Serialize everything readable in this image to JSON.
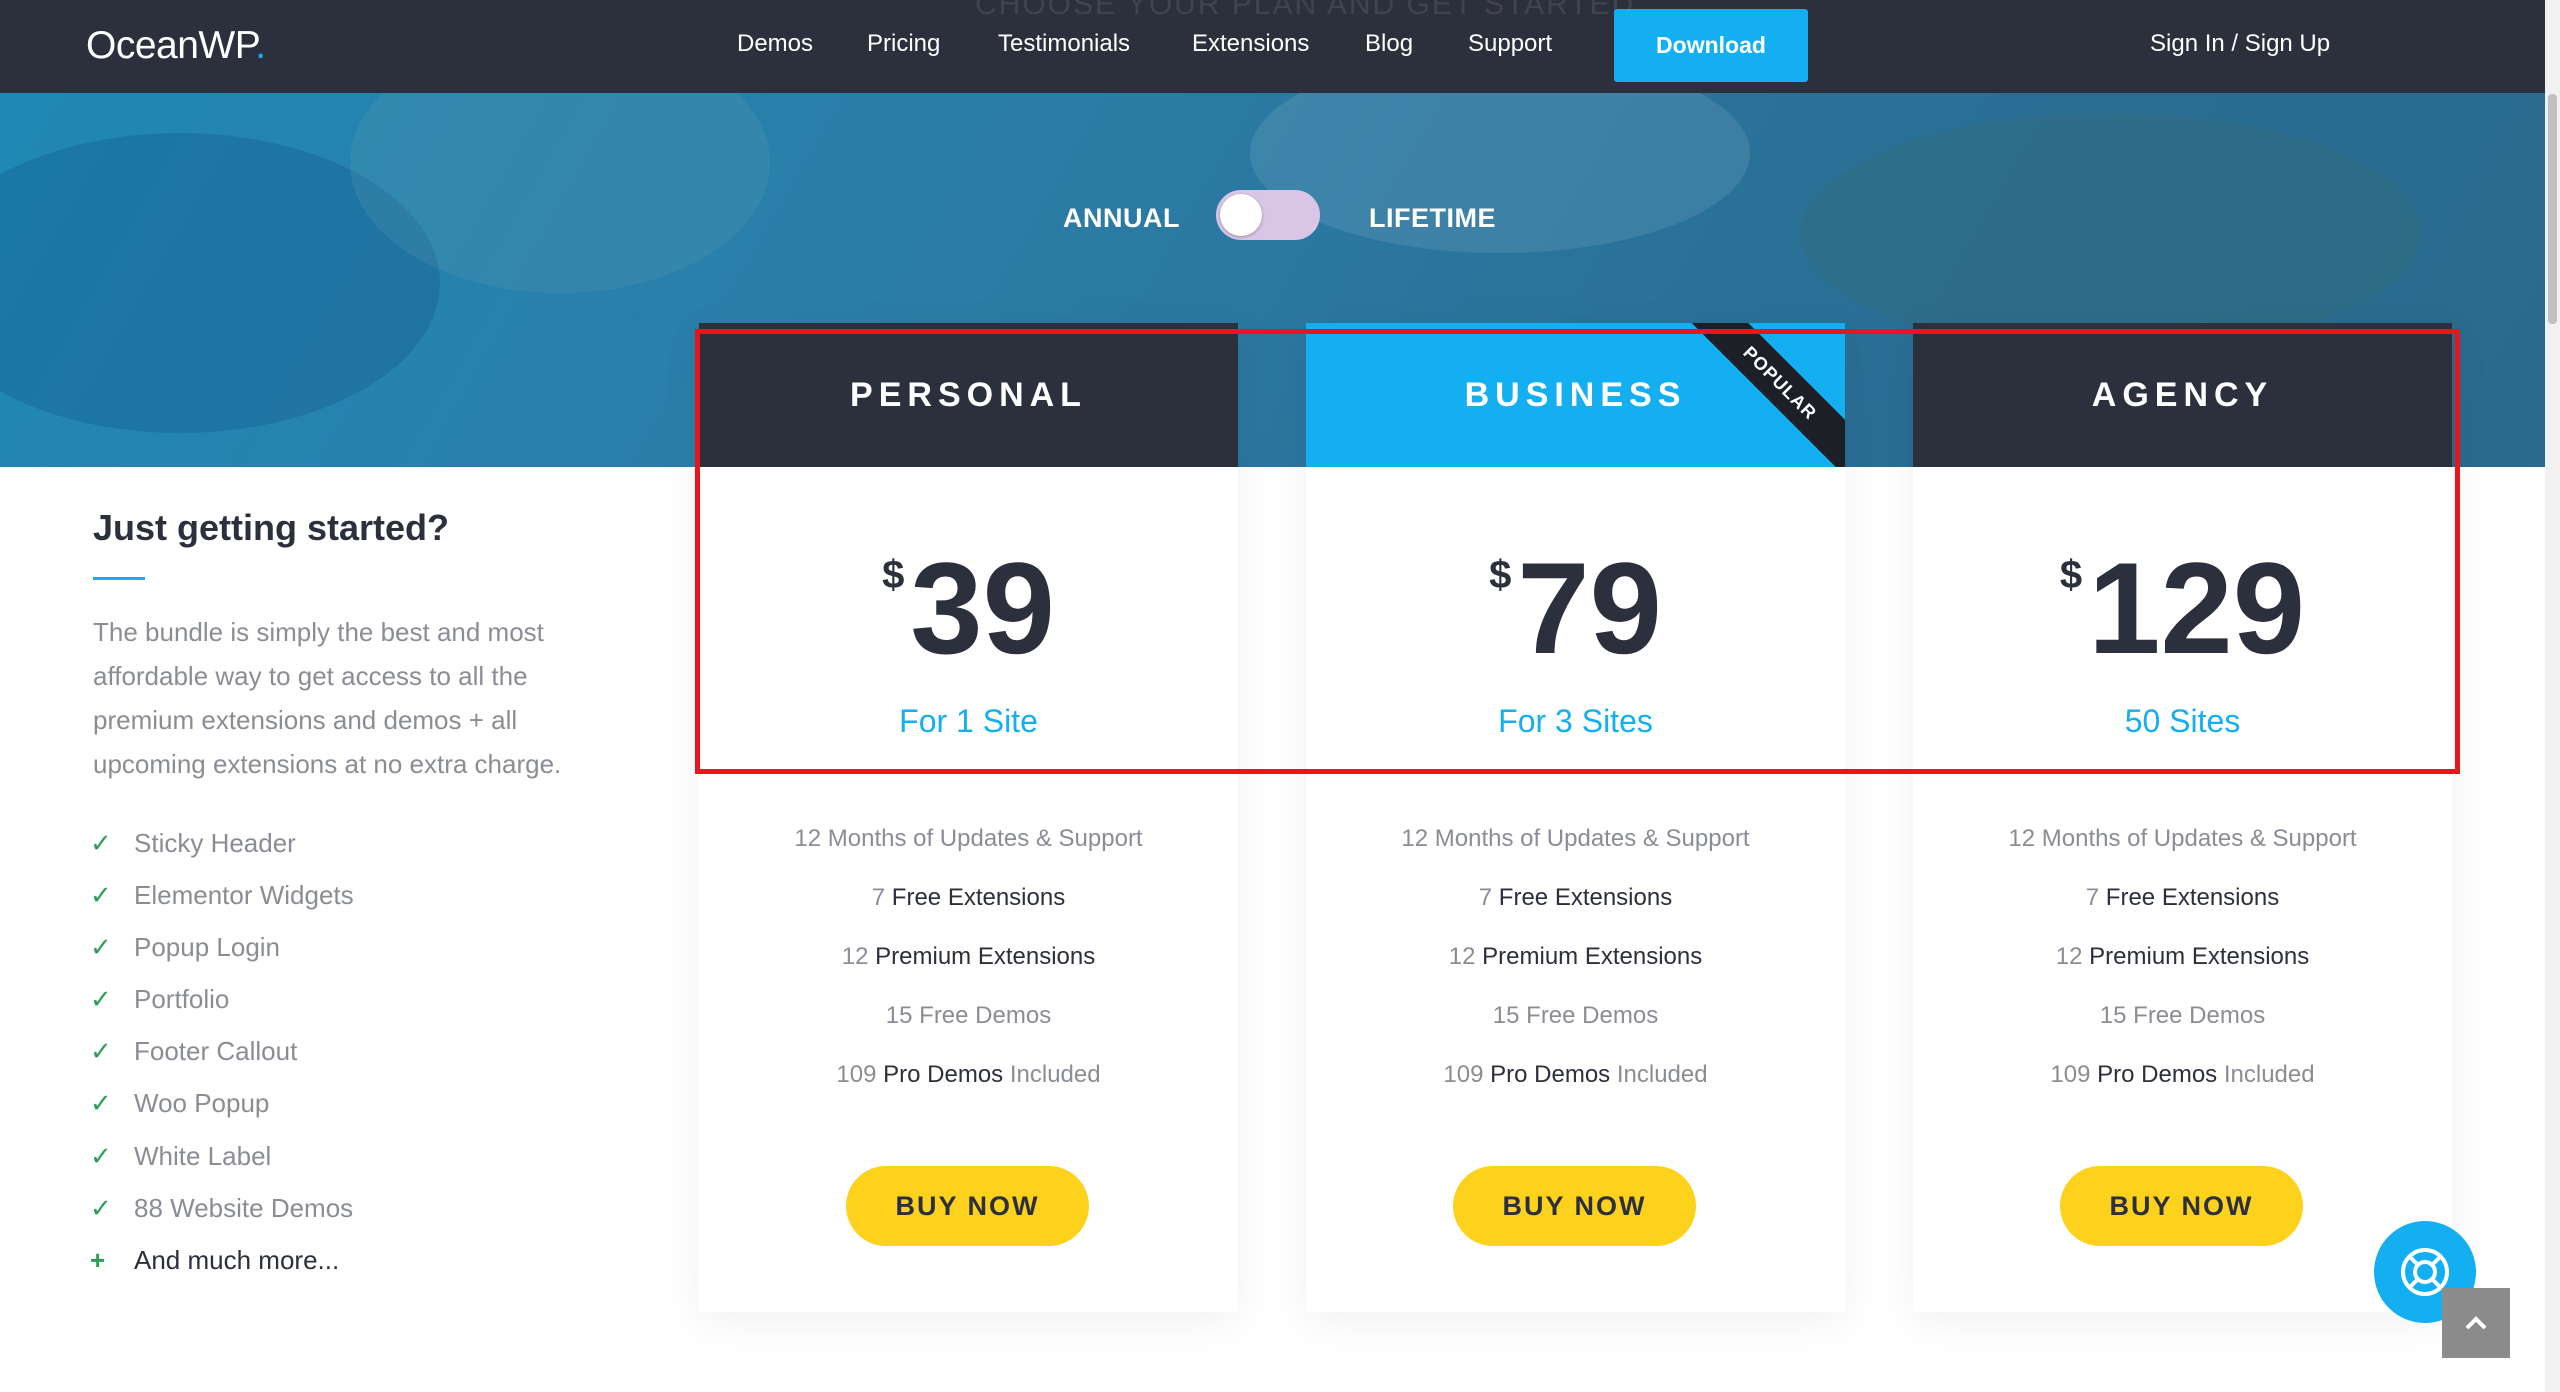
{
  "header": {
    "logo_text": "OceanWP",
    "logo_dot": ".",
    "ghost_heading": "CHOOSE YOUR PLAN AND GET STARTED",
    "nav": [
      "Demos",
      "Pricing",
      "Testimonials",
      "Extensions",
      "Blog",
      "Support"
    ],
    "download_label": "Download",
    "signin_label": "Sign In / Sign Up"
  },
  "billing_toggle": {
    "left_label": "ANNUAL",
    "right_label": "LIFETIME",
    "state": "annual"
  },
  "intro": {
    "title": "Just getting started?",
    "description": "The bundle is simply the best and most affordable way to get access to all the premium extensions and demos + all upcoming extensions at no extra charge.",
    "features": [
      "Sticky Header",
      "Elementor Widgets",
      "Popup Login",
      "Portfolio",
      "Footer Callout",
      "Woo Popup",
      "White Label",
      "88 Website Demos"
    ],
    "more_label": "And much more..."
  },
  "plans": [
    {
      "name": "PERSONAL",
      "currency": "$",
      "price": "39",
      "sites": "For 1 Site",
      "popular": false,
      "features": [
        {
          "num": "12",
          "text": "Months of Updates & Support",
          "rest": ""
        },
        {
          "num": "7",
          "text": "Free Extensions",
          "rest": ""
        },
        {
          "num": "12",
          "text": "Premium Extensions",
          "rest": ""
        },
        {
          "num": "15",
          "text": "Free Demos",
          "rest": ""
        },
        {
          "num": "109",
          "text": "Pro Demos",
          "rest": "Included"
        }
      ],
      "button": "BUY NOW"
    },
    {
      "name": "BUSINESS",
      "currency": "$",
      "price": "79",
      "sites": "For 3 Sites",
      "popular": true,
      "ribbon": "POPULAR",
      "features": [
        {
          "num": "12",
          "text": "Months of Updates & Support",
          "rest": ""
        },
        {
          "num": "7",
          "text": "Free Extensions",
          "rest": ""
        },
        {
          "num": "12",
          "text": "Premium Extensions",
          "rest": ""
        },
        {
          "num": "15",
          "text": "Free Demos",
          "rest": ""
        },
        {
          "num": "109",
          "text": "Pro Demos",
          "rest": "Included"
        }
      ],
      "button": "BUY NOW"
    },
    {
      "name": "AGENCY",
      "currency": "$",
      "price": "129",
      "sites": "50 Sites",
      "popular": false,
      "features": [
        {
          "num": "12",
          "text": "Months of Updates & Support",
          "rest": ""
        },
        {
          "num": "7",
          "text": "Free Extensions",
          "rest": ""
        },
        {
          "num": "12",
          "text": "Premium Extensions",
          "rest": ""
        },
        {
          "num": "15",
          "text": "Free Demos",
          "rest": ""
        },
        {
          "num": "109",
          "text": "Pro Demos",
          "rest": "Included"
        }
      ],
      "button": "BUY NOW"
    }
  ],
  "colors": {
    "accent": "#13aff0",
    "dark": "#2c2f3c",
    "buy_button": "#fcd21d",
    "highlight": "#e8141e"
  },
  "icons": {
    "feature_check": "check-icon",
    "more": "plus-icon",
    "help": "lifebuoy-icon",
    "back_to_top": "chevron-up-icon"
  }
}
